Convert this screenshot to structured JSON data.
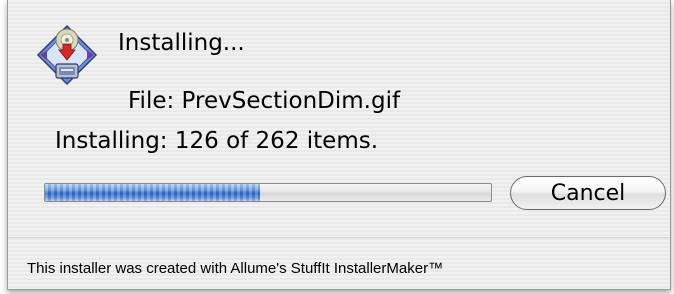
{
  "dialog": {
    "icon": "installer-disc-icon",
    "title": "Installing...",
    "file_label": "File: PrevSectionDim.gif",
    "count_label": "Installing: 126 of  262 items.",
    "progress": {
      "current": 126,
      "total": 262,
      "fraction": 0.481
    },
    "cancel_label": "Cancel",
    "footer": "This installer was created with Allume's StuffIt InstallerMaker™"
  }
}
